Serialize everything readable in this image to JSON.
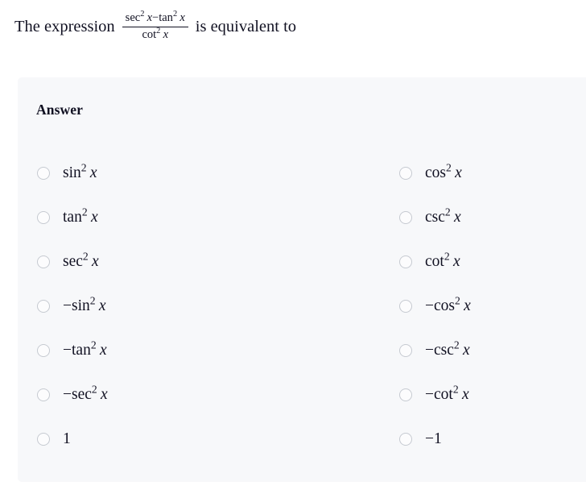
{
  "question": {
    "prefix": "The expression",
    "suffix": "is equivalent to",
    "expression": {
      "numerator": "sec² x − tan² x",
      "denominator": "cot² x",
      "numerator_parts": {
        "first_func": "sec",
        "first_exp": "2",
        "first_var": "x",
        "operator": "−",
        "second_func": "tan",
        "second_exp": "2",
        "second_var": "x"
      },
      "denominator_parts": {
        "func": "cot",
        "exp": "2",
        "var": "x"
      }
    }
  },
  "answer_section": {
    "heading": "Answer",
    "rows": [
      {
        "left": {
          "sign": "",
          "func": "sin",
          "exp": "2",
          "var": "x",
          "plain": ""
        },
        "right": {
          "sign": "",
          "func": "cos",
          "exp": "2",
          "var": "x",
          "plain": ""
        }
      },
      {
        "left": {
          "sign": "",
          "func": "tan",
          "exp": "2",
          "var": "x",
          "plain": ""
        },
        "right": {
          "sign": "",
          "func": "csc",
          "exp": "2",
          "var": "x",
          "plain": ""
        }
      },
      {
        "left": {
          "sign": "",
          "func": "sec",
          "exp": "2",
          "var": "x",
          "plain": ""
        },
        "right": {
          "sign": "",
          "func": "cot",
          "exp": "2",
          "var": "x",
          "plain": ""
        }
      },
      {
        "left": {
          "sign": "− ",
          "func": "sin",
          "exp": "2",
          "var": "x",
          "plain": ""
        },
        "right": {
          "sign": "− ",
          "func": "cos",
          "exp": "2",
          "var": "x",
          "plain": ""
        }
      },
      {
        "left": {
          "sign": "− ",
          "func": "tan",
          "exp": "2",
          "var": "x",
          "plain": ""
        },
        "right": {
          "sign": "− ",
          "func": "csc",
          "exp": "2",
          "var": "x",
          "plain": ""
        }
      },
      {
        "left": {
          "sign": "− ",
          "func": "sec",
          "exp": "2",
          "var": "x",
          "plain": ""
        },
        "right": {
          "sign": "− ",
          "func": "cot",
          "exp": "2",
          "var": "x",
          "plain": ""
        }
      },
      {
        "left": {
          "sign": "",
          "func": "",
          "exp": "",
          "var": "",
          "plain": "1"
        },
        "right": {
          "sign": "",
          "func": "",
          "exp": "",
          "var": "",
          "plain": "−1"
        }
      }
    ],
    "selected": null
  },
  "colors": {
    "page_background": "#ffffff",
    "panel_background": "#f7f8fa",
    "text": "#111122",
    "radio_border": "#c6cad1",
    "radio_fill": "#fcfcfd"
  }
}
